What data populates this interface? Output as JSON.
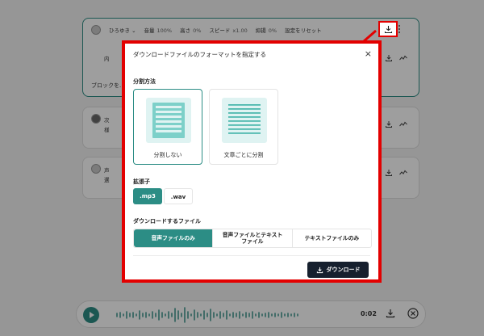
{
  "background": {
    "toolbar": {
      "speaker": "ひろゆき",
      "volume_label": "音量",
      "volume_value": "100%",
      "pitch_label": "高さ",
      "pitch_value": "0%",
      "speed_label": "スピード",
      "speed_value": "x1.00",
      "intonation_label": "抑揚",
      "intonation_value": "0%",
      "reset_label": "設定をリセット"
    },
    "row1_text": "内",
    "row2_text_line1": "次",
    "row2_text_line2": "様",
    "row3_text_line1": "声",
    "row3_text_line2": "選",
    "add_block_label": "ブロックを..."
  },
  "player": {
    "time": "0:02"
  },
  "modal": {
    "title": "ダウンロードファイルのフォーマットを指定する",
    "close_label": "×",
    "split_section_label": "分割方法",
    "split_options": [
      {
        "label": "分割しない",
        "selected": true
      },
      {
        "label": "文章ごとに分割",
        "selected": false
      }
    ],
    "ext_section_label": "拡張子",
    "ext_options": [
      {
        "label": ".mp3",
        "selected": true
      },
      {
        "label": ".wav",
        "selected": false
      }
    ],
    "file_section_label": "ダウンロードするファイル",
    "file_options": [
      {
        "label": "音声ファイルのみ",
        "selected": true
      },
      {
        "label": "音声ファイルとテキスト\nファイル",
        "selected": false
      },
      {
        "label": "テキストファイルのみ",
        "selected": false
      }
    ],
    "download_label": "ダウンロード"
  },
  "colors": {
    "accent": "#2c8d85",
    "highlight": "#e30000",
    "download_button": "#16202e"
  }
}
